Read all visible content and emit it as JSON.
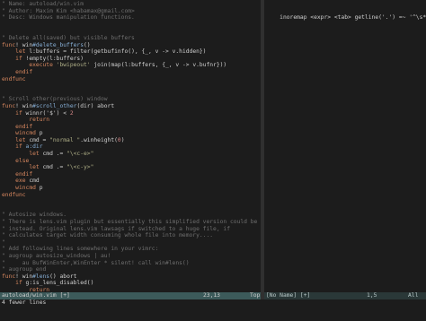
{
  "left_buffer": {
    "lines": [
      [
        {
          "t": "\" Name: autoload/win.vim",
          "c": "comment"
        }
      ],
      [
        {
          "t": "\" Author: Maxim Kim <habamax@gmail.com>",
          "c": "comment"
        }
      ],
      [
        {
          "t": "\" Desc: Windows manipulation functions.",
          "c": "comment"
        }
      ],
      [
        {
          "t": "",
          "c": "norm"
        }
      ],
      [
        {
          "t": "",
          "c": "norm"
        }
      ],
      [
        {
          "t": "\" Delete all(saved) but visible buffers",
          "c": "comment"
        }
      ],
      [
        {
          "t": "func",
          "c": "keyword"
        },
        {
          "t": "! win",
          "c": "norm"
        },
        {
          "t": "#delete_buffers",
          "c": "def"
        },
        {
          "t": "()",
          "c": "norm"
        }
      ],
      [
        {
          "t": "    let ",
          "c": "keyword"
        },
        {
          "t": "l:buffers = filter(getbufinfo(), {_, v -> v.hidden})",
          "c": "norm"
        }
      ],
      [
        {
          "t": "    if ",
          "c": "keyword"
        },
        {
          "t": "!empty(l:buffers)",
          "c": "norm"
        }
      ],
      [
        {
          "t": "        execute ",
          "c": "keyword"
        },
        {
          "t": "'bwipeout' ",
          "c": "str"
        },
        {
          "t": "join(map(l:buffers, {_, v -> v.bufnr}))",
          "c": "norm"
        }
      ],
      [
        {
          "t": "    endif",
          "c": "keyword"
        }
      ],
      [
        {
          "t": "endfunc",
          "c": "keyword"
        }
      ],
      [
        {
          "t": "",
          "c": "norm"
        }
      ],
      [
        {
          "t": "",
          "c": "norm"
        }
      ],
      [
        {
          "t": "\" Scroll other(previous) window",
          "c": "comment"
        }
      ],
      [
        {
          "t": "func",
          "c": "keyword"
        },
        {
          "t": "! win",
          "c": "norm"
        },
        {
          "t": "#scroll_other",
          "c": "def"
        },
        {
          "t": "(dir) abort",
          "c": "norm"
        }
      ],
      [
        {
          "t": "    if ",
          "c": "keyword"
        },
        {
          "t": "winnr('$') < ",
          "c": "norm"
        },
        {
          "t": "2",
          "c": "num"
        }
      ],
      [
        {
          "t": "        return",
          "c": "keyword"
        }
      ],
      [
        {
          "t": "    endif",
          "c": "keyword"
        }
      ],
      [
        {
          "t": "    wincmd ",
          "c": "keyword"
        },
        {
          "t": "p",
          "c": "norm"
        }
      ],
      [
        {
          "t": "    let ",
          "c": "keyword"
        },
        {
          "t": "cmd = ",
          "c": "norm"
        },
        {
          "t": "\"normal \"",
          "c": "str"
        },
        {
          "t": ".winheight(",
          "c": "norm"
        },
        {
          "t": "0",
          "c": "num"
        },
        {
          "t": ")",
          "c": "norm"
        }
      ],
      [
        {
          "t": "    if ",
          "c": "keyword"
        },
        {
          "t": "a:dir",
          "c": "blue"
        }
      ],
      [
        {
          "t": "        let ",
          "c": "keyword"
        },
        {
          "t": "c",
          "c": "cursor"
        },
        {
          "t": "md .= ",
          "c": "norm"
        },
        {
          "t": "\"\\<c-e>\"",
          "c": "str"
        }
      ],
      [
        {
          "t": "    else",
          "c": "keyword"
        }
      ],
      [
        {
          "t": "        let ",
          "c": "keyword"
        },
        {
          "t": "cmd .= ",
          "c": "norm"
        },
        {
          "t": "\"\\<c-y>\"",
          "c": "str"
        }
      ],
      [
        {
          "t": "    endif",
          "c": "keyword"
        }
      ],
      [
        {
          "t": "    exe ",
          "c": "keyword"
        },
        {
          "t": "cmd",
          "c": "norm"
        }
      ],
      [
        {
          "t": "    wincmd ",
          "c": "keyword"
        },
        {
          "t": "p",
          "c": "norm"
        }
      ],
      [
        {
          "t": "endfunc",
          "c": "keyword"
        }
      ],
      [
        {
          "t": "",
          "c": "norm"
        }
      ],
      [
        {
          "t": "",
          "c": "norm"
        }
      ],
      [
        {
          "t": "\" Autosize windows.",
          "c": "comment"
        }
      ],
      [
        {
          "t": "\" There is lens.vim plugin but essentially this simplified version could be us",
          "c": "comment"
        }
      ],
      [
        {
          "t": "\" instead. Original lens.vim lawsags if switched to a huge file, if",
          "c": "comment"
        }
      ],
      [
        {
          "t": "\" calculates target width consuming whole file into memory....",
          "c": "comment"
        }
      ],
      [
        {
          "t": "\"",
          "c": "comment"
        }
      ],
      [
        {
          "t": "\" Add following lines somewhere in your vimrc:",
          "c": "comment"
        }
      ],
      [
        {
          "t": "\" augroup autosize_windows | au!",
          "c": "comment"
        }
      ],
      [
        {
          "t": "\"     au BufWinEnter,WinEnter * silent! call win#lens()",
          "c": "comment"
        }
      ],
      [
        {
          "t": "\" augroup end",
          "c": "comment"
        }
      ],
      [
        {
          "t": "func",
          "c": "keyword"
        },
        {
          "t": "! win",
          "c": "norm"
        },
        {
          "t": "#lens",
          "c": "def"
        },
        {
          "t": "() abort",
          "c": "norm"
        }
      ],
      [
        {
          "t": "    if ",
          "c": "keyword"
        },
        {
          "t": "g:is_lens_disabled()",
          "c": "norm"
        }
      ],
      [
        {
          "t": "        return",
          "c": "keyword"
        }
      ],
      [
        {
          "t": "    endif",
          "c": "keyword"
        }
      ]
    ]
  },
  "right_buffer": {
    "line": "    inoremap <expr> <tab> getline('.') =~ '^\\s*$'"
  },
  "status_left": {
    "filename": "autoload/win.vim [+]",
    "position": "23,13",
    "scroll": "Top"
  },
  "status_right": {
    "filename": "[No Name] [+]",
    "position": "1,5",
    "scroll": "All"
  },
  "cmdline": "4 fewer lines",
  "colors": {
    "comment": "#6e6e6e",
    "keyword": "#d7875f",
    "function_name": "#87afd7",
    "string": "#afaf87",
    "number": "#d78787",
    "background": "#1c1c1c",
    "statusline": "#3c5a5a"
  }
}
